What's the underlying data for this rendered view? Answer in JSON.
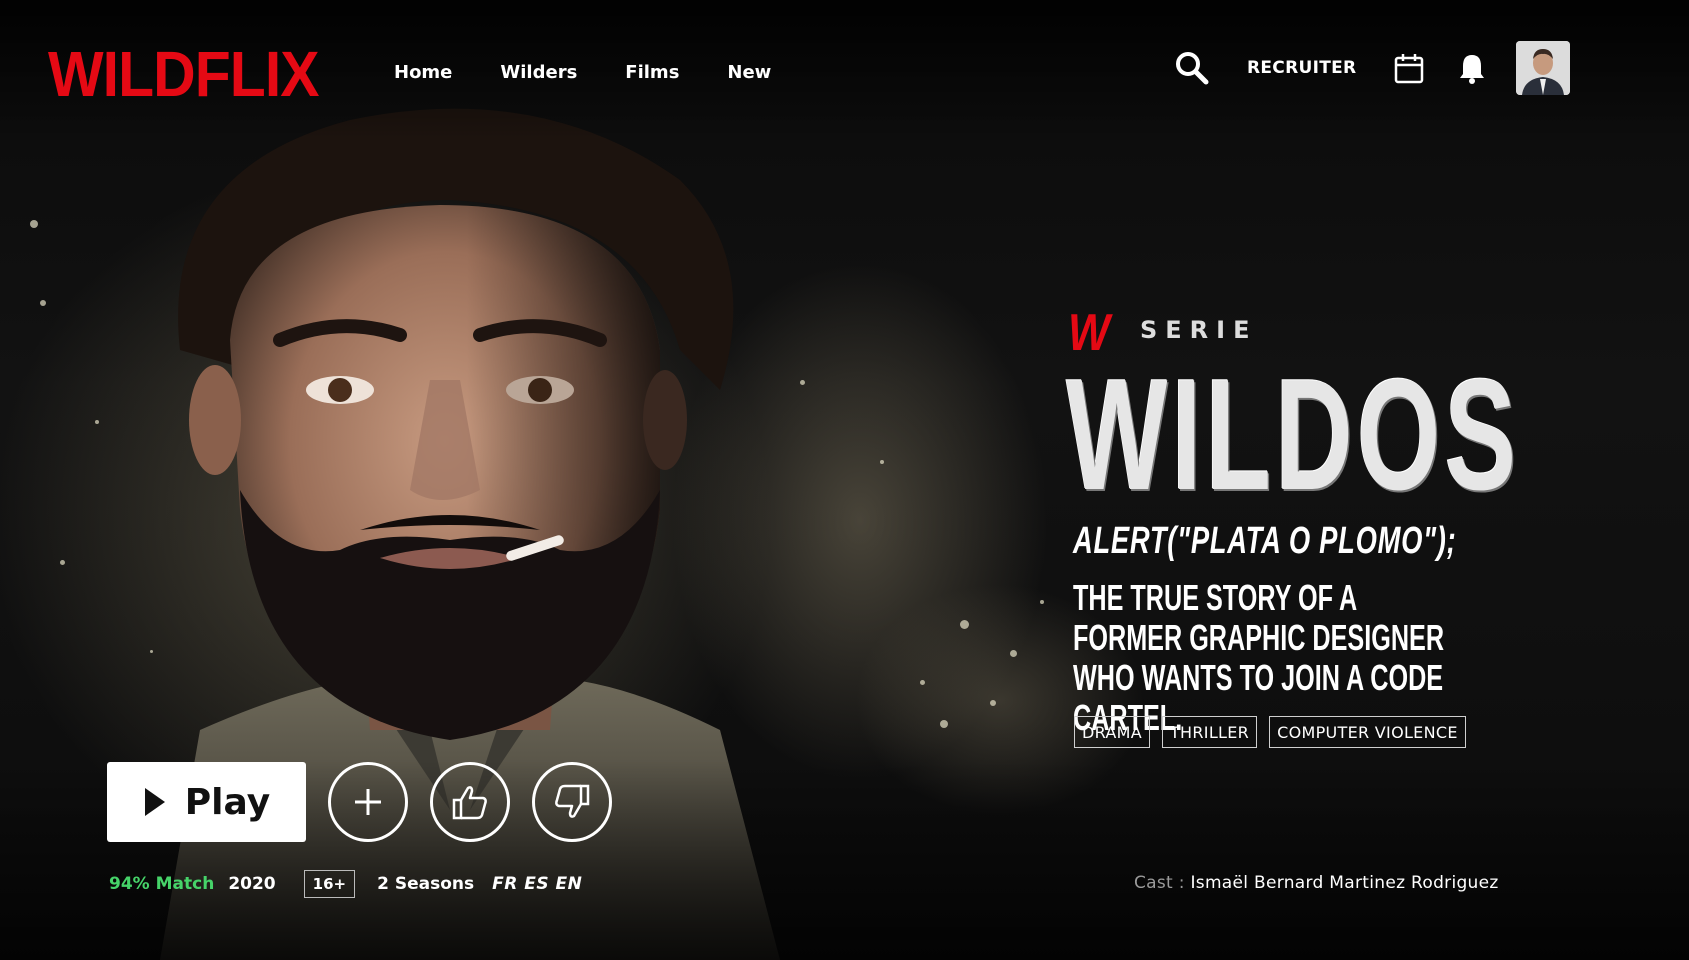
{
  "brand": {
    "logo": "WILDFLIX",
    "accent": "#e50914"
  },
  "nav": {
    "links": [
      "Home",
      "Wilders",
      "Films",
      "New"
    ],
    "recruiter": "RECRUITER"
  },
  "icons": {
    "search": "search-icon",
    "calendar": "calendar-icon",
    "bell": "bell-icon",
    "avatar": "profile-avatar"
  },
  "show": {
    "badge": "W",
    "type": "SERIE",
    "title": "WILDOS",
    "tagline": "ALERT(\"PLATA O PLOMO\");",
    "description": "THE TRUE STORY OF A FORMER GRAPHIC DESIGNER WHO WANTS TO JOIN A CODE CARTEL.",
    "genres": [
      "DRAMA",
      "THRILLER",
      "COMPUTER VIOLENCE"
    ]
  },
  "actions": {
    "play": "Play",
    "add": "+"
  },
  "meta": {
    "match": "94% Match",
    "year": "2020",
    "rating": "16+",
    "seasons": "2 Seasons",
    "languages": "FR ES EN",
    "match_color": "#46d369"
  },
  "cast": {
    "label": "Cast :",
    "names": "Ismaël Bernard Martinez Rodriguez"
  }
}
